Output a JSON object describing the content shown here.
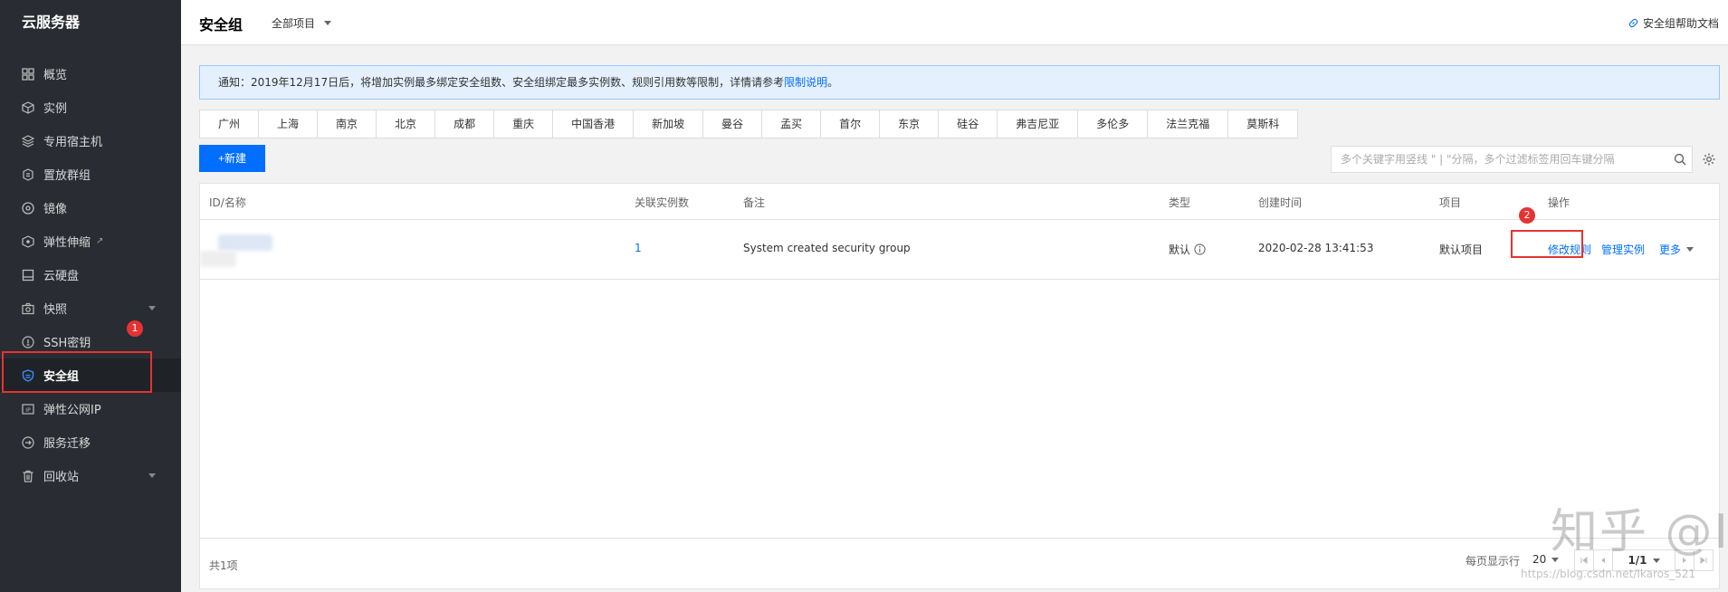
{
  "sidebar": {
    "title": "云服务器",
    "items": [
      {
        "label": "概览",
        "icon": "grid-icon"
      },
      {
        "label": "实例",
        "icon": "cube-icon"
      },
      {
        "label": "专用宿主机",
        "icon": "layers-icon"
      },
      {
        "label": "置放群组",
        "icon": "group-icon"
      },
      {
        "label": "镜像",
        "icon": "disc-icon"
      },
      {
        "label": "弹性伸缩",
        "icon": "scale-icon"
      },
      {
        "label": "云硬盘",
        "icon": "disk-icon"
      },
      {
        "label": "快照",
        "icon": "camera-icon"
      },
      {
        "label": "SSH密钥",
        "icon": "key-icon"
      },
      {
        "label": "安全组",
        "icon": "shield-icon"
      },
      {
        "label": "弹性公网IP",
        "icon": "ip-icon"
      },
      {
        "label": "服务迁移",
        "icon": "migrate-icon"
      },
      {
        "label": "回收站",
        "icon": "trash-icon"
      }
    ],
    "badge1": "1"
  },
  "header": {
    "title": "安全组",
    "project": "全部项目",
    "help": "安全组帮助文档"
  },
  "notice": {
    "text": "通知：2019年12月17日后，将增加实例最多绑定安全组数、安全组绑定最多实例数、规则引用数等限制，详情请参考",
    "link": "限制说明",
    "end": "。"
  },
  "regions": [
    "广州",
    "上海",
    "南京",
    "北京",
    "成都",
    "重庆",
    "中国香港",
    "新加坡",
    "曼谷",
    "孟买",
    "首尔",
    "东京",
    "硅谷",
    "弗吉尼亚",
    "多伦多",
    "法兰克福",
    "莫斯科"
  ],
  "toolbar": {
    "new_label": "+新建",
    "search_placeholder": "多个关键字用竖线 \" | \"分隔，多个过滤标签用回车键分隔"
  },
  "table": {
    "headers": {
      "id": "ID/名称",
      "count": "关联实例数",
      "remark": "备注",
      "type": "类型",
      "created": "创建时间",
      "project": "项目",
      "ops": "操作"
    },
    "rows": [
      {
        "count": "1",
        "remark": "System created security group",
        "type": "默认",
        "created": "2020-02-28 13:41:53",
        "project": "默认项目",
        "op_edit": "修改规则",
        "op_manage": "管理实例",
        "op_more": "更多"
      }
    ],
    "badge2": "2"
  },
  "footer": {
    "total": "共1项",
    "perpage_label": "每页显示行",
    "perpage": "20",
    "page": "1/1"
  },
  "watermark": {
    "big": "知乎 @Ikaros",
    "small": "https://blog.csdn.net/Ikaros_521"
  },
  "colors": {
    "accent": "#006eff",
    "sidebar_bg": "#292d33",
    "highlight": "#e53333"
  }
}
